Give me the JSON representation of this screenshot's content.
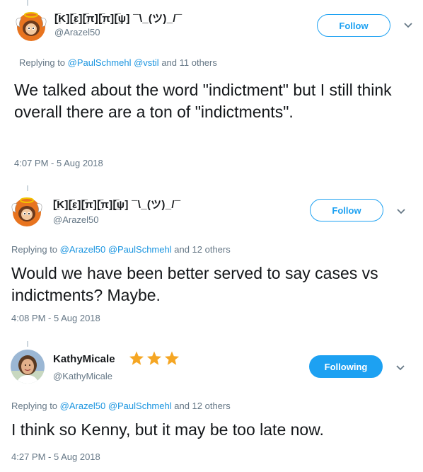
{
  "tweets": [
    {
      "display_name": "[̲̅K][̲̅ε][̲̅π][̲̅π][̲̅ψ] ¯\\_(ツ)_/¯",
      "handle": "@Arazel50",
      "button": "Follow",
      "reply_prefix": "Replying to",
      "mentions": [
        "@PaulSchmehl",
        "@vstil"
      ],
      "reply_suffix": "and 11 others",
      "text": "We talked about the word \"indictment\" but I still think overall there are a ton of \"indictments\".",
      "timestamp": "4:07 PM - 5 Aug 2018"
    },
    {
      "display_name": "[̲̅K][̲̅ε][̲̅π][̲̅π][̲̅ψ] ¯\\_(ツ)_/¯",
      "handle": "@Arazel50",
      "button": "Follow",
      "reply_prefix": "Replying to",
      "mentions": [
        "@Arazel50",
        "@PaulSchmehl"
      ],
      "reply_suffix": "and 12 others",
      "text": "Would we have been better served to say cases vs indictments? Maybe.",
      "timestamp": "4:08 PM - 5 Aug 2018"
    },
    {
      "display_name": "KathyMicale",
      "handle": "@KathyMicale",
      "button": "Following",
      "reply_prefix": "Replying to",
      "mentions": [
        "@Arazel50",
        "@PaulSchmehl"
      ],
      "reply_suffix": "and 12 others",
      "text": "I think so Kenny, but it may be too late now.",
      "timestamp": "4:27 PM - 5 Aug 2018"
    }
  ],
  "colors": {
    "accent": "#1da1f2",
    "mention": "#1b95e0",
    "muted": "#657786",
    "star": "#f5a623"
  },
  "icons": [
    "kenny-avatar-icon",
    "kathy-avatar-icon",
    "chevron-down-icon",
    "star-icon"
  ]
}
